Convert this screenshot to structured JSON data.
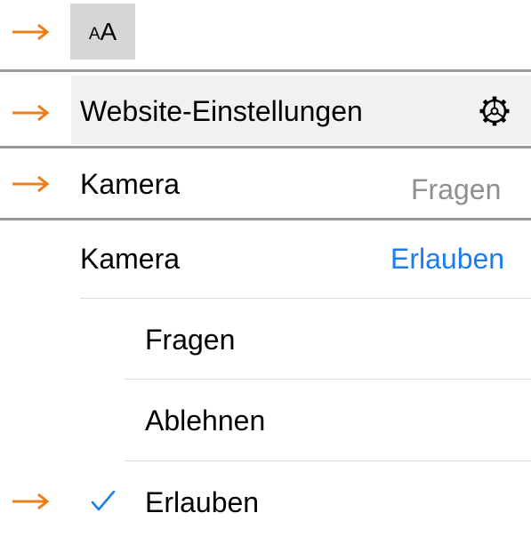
{
  "colors": {
    "arrow": "#f07d17",
    "accent_blue": "#1b7cf2",
    "value_gray": "#8e8e93",
    "toolbar_button_bg": "#d6d6d6",
    "highlight_bg": "#f1f1f1",
    "divider": "#999999"
  },
  "toolbar": {
    "text_size_small": "A",
    "text_size_large": "A"
  },
  "menu": {
    "website_settings_label": "Website-Einstellungen",
    "website_settings_icon": "gear-icon"
  },
  "camera_summary": {
    "label": "Kamera",
    "value": "Fragen"
  },
  "camera_setting": {
    "label": "Kamera",
    "value": "Erlauben",
    "options": [
      {
        "label": "Fragen",
        "selected": false
      },
      {
        "label": "Ablehnen",
        "selected": false
      },
      {
        "label": "Erlauben",
        "selected": true
      }
    ],
    "checkmark_icon": "checkmark-icon"
  }
}
